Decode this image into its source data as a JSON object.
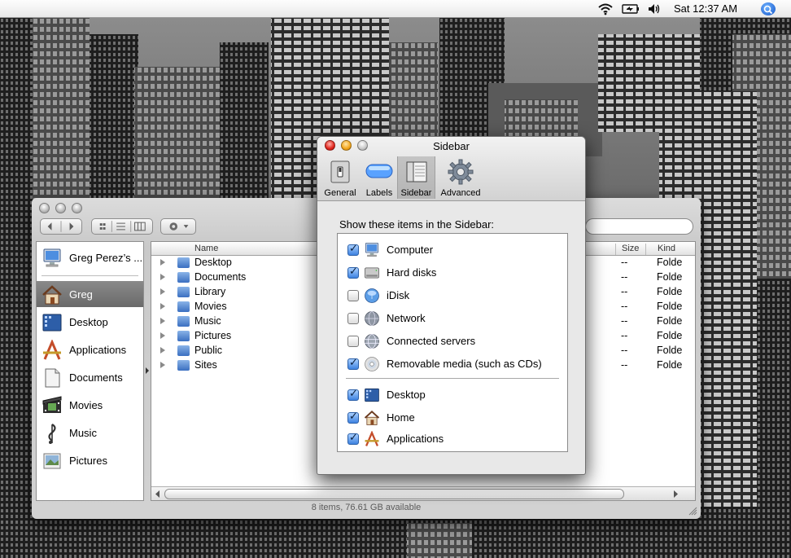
{
  "menubar": {
    "clock": "Sat 12:37 AM",
    "status_icons": [
      "wifi-icon",
      "battery-icon",
      "volume-icon",
      "spotlight-icon"
    ]
  },
  "finder": {
    "sidebar": [
      {
        "label": "Greg Perez’s ...",
        "icon": "computer-icon"
      },
      {
        "label": "Greg",
        "icon": "home-icon",
        "selected": true
      },
      {
        "label": "Desktop",
        "icon": "desktop-icon"
      },
      {
        "label": "Applications",
        "icon": "applications-icon"
      },
      {
        "label": "Documents",
        "icon": "documents-icon"
      },
      {
        "label": "Movies",
        "icon": "movies-icon"
      },
      {
        "label": "Music",
        "icon": "music-icon"
      },
      {
        "label": "Pictures",
        "icon": "pictures-icon"
      }
    ],
    "columns": {
      "name": "Name",
      "size": "Size",
      "kind": "Kind"
    },
    "rows": [
      {
        "name": "Desktop",
        "size": "--",
        "kind": "Folde"
      },
      {
        "name": "Documents",
        "size": "--",
        "kind": "Folde"
      },
      {
        "name": "Library",
        "size": "--",
        "kind": "Folde"
      },
      {
        "name": "Movies",
        "size": "--",
        "kind": "Folde"
      },
      {
        "name": "Music",
        "size": "--",
        "kind": "Folde"
      },
      {
        "name": "Pictures",
        "size": "--",
        "kind": "Folde"
      },
      {
        "name": "Public",
        "size": "--",
        "kind": "Folde"
      },
      {
        "name": "Sites",
        "size": "--",
        "kind": "Folde"
      }
    ],
    "status": "8 items, 76.61 GB available"
  },
  "prefs": {
    "title": "Sidebar",
    "toolbar": [
      {
        "label": "General",
        "icon": "general-icon"
      },
      {
        "label": "Labels",
        "icon": "labels-icon"
      },
      {
        "label": "Sidebar",
        "icon": "sidebar-icon",
        "selected": true
      },
      {
        "label": "Advanced",
        "icon": "gear-icon"
      }
    ],
    "heading": "Show these items in the Sidebar:",
    "options": [
      {
        "label": "Computer",
        "checked": true,
        "icon": "computer-icon"
      },
      {
        "label": "Hard disks",
        "checked": true,
        "icon": "hard-disk-icon"
      },
      {
        "label": "iDisk",
        "checked": false,
        "icon": "idisk-icon"
      },
      {
        "label": "Network",
        "checked": false,
        "icon": "network-icon"
      },
      {
        "label": "Connected servers",
        "checked": false,
        "icon": "server-icon"
      },
      {
        "label": "Removable media (such as CDs)",
        "checked": true,
        "icon": "cd-icon"
      },
      {
        "label": "Desktop",
        "checked": true,
        "icon": "desktop-icon"
      },
      {
        "label": "Home",
        "checked": true,
        "icon": "home-icon"
      },
      {
        "label": "Applications",
        "checked": true,
        "icon": "applications-icon"
      }
    ]
  }
}
